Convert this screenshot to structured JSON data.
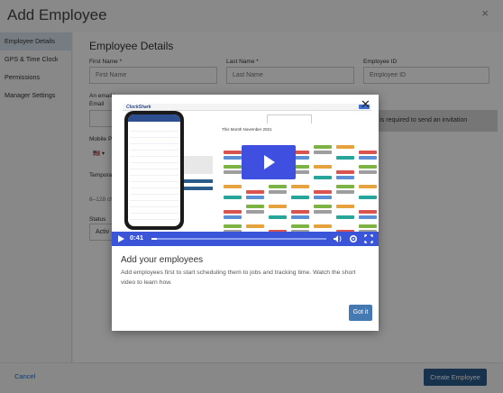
{
  "window": {
    "title": "Add Employee",
    "close": "×"
  },
  "sidebar": {
    "items": [
      {
        "label": "Employee Details",
        "active": true
      },
      {
        "label": "GPS & Time Clock",
        "active": false
      },
      {
        "label": "Permissions",
        "active": false
      },
      {
        "label": "Manager Settings",
        "active": false
      }
    ]
  },
  "form": {
    "section_title": "Employee Details",
    "first_name": {
      "label": "First Name *",
      "placeholder": "First Name"
    },
    "last_name": {
      "label": "Last Name *",
      "placeholder": "Last Name"
    },
    "employee_id": {
      "label": "Employee ID",
      "placeholder": "Employee ID"
    },
    "email_note": "An email i",
    "email_label": "Email",
    "banner_text": "r is required to send an invitation",
    "mobile_label": "Mobile Ph",
    "flag_glyph": "🇺🇸 ▾",
    "temp_label": "Tempora",
    "chars_note": "8–128 ch",
    "status_label": "Status",
    "status_value": "Activ"
  },
  "footer": {
    "cancel": "Cancel",
    "create": "Create Employee"
  },
  "modal": {
    "close": "✕",
    "video": {
      "time": "0:41",
      "progress": 0.03,
      "brand": "ClockShark",
      "month_title": "This Month  November 2021"
    },
    "title": "Add your employees",
    "description": "Add employees first to start scheduling them to jobs and tracking time. Watch the short video to learn how.",
    "button": "Got it"
  },
  "colors": {
    "accent": "#3b55d9",
    "primary_button": "#2b5b8a",
    "got_it": "#4479b2",
    "active_nav": "#d6e4ef"
  }
}
